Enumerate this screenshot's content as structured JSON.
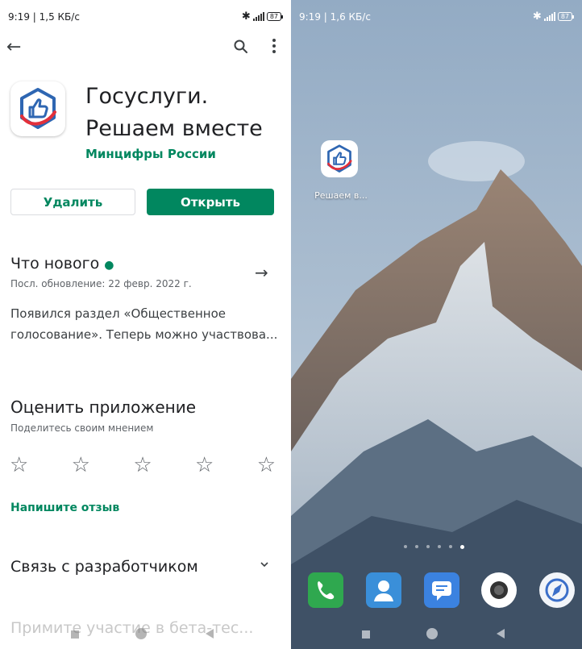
{
  "left_screen": {
    "status": {
      "time": "9:19 | 1,5 КБ/с",
      "battery": "87",
      "signal_label": "4G"
    },
    "topbar": {
      "back_icon": "arrow-left-icon",
      "search_icon": "search-icon",
      "more_icon": "more-vert-icon"
    },
    "app": {
      "title": "Госуслуги. Решаем вместе",
      "developer": "Минцифры России",
      "uninstall_label": "Удалить",
      "open_label": "Открыть"
    },
    "whats_new": {
      "title": "Что нового",
      "updated": "Посл. обновление: 22 февр. 2022 г.",
      "body": "Появился раздел «Общественное голосование». Теперь можно участвова..."
    },
    "rate": {
      "title": "Оценить приложение",
      "subtitle": "Поделитесь своим мнением",
      "star_glyph": "☆",
      "stars_total": 5,
      "write_review": "Напишите отзыв"
    },
    "contact": {
      "title": "Связь с разработчиком"
    },
    "beta": {
      "title": "Примите участие в бета-тес..."
    }
  },
  "right_screen": {
    "status": {
      "time": "9:19 | 1,6 КБ/с",
      "battery": "87",
      "signal_label": "4G"
    },
    "home_app": {
      "label": "Решаем в..."
    },
    "dock_apps": [
      "phone-icon",
      "contacts-icon",
      "messages-icon",
      "camera-icon",
      "browser-icon"
    ],
    "page_dots": 6,
    "active_dot": 5
  },
  "colors": {
    "accent_green": "#01875f",
    "text_primary": "#202124",
    "text_secondary": "#5f6368",
    "icon_blue": "#2e66b2",
    "icon_red": "#e3303a"
  }
}
